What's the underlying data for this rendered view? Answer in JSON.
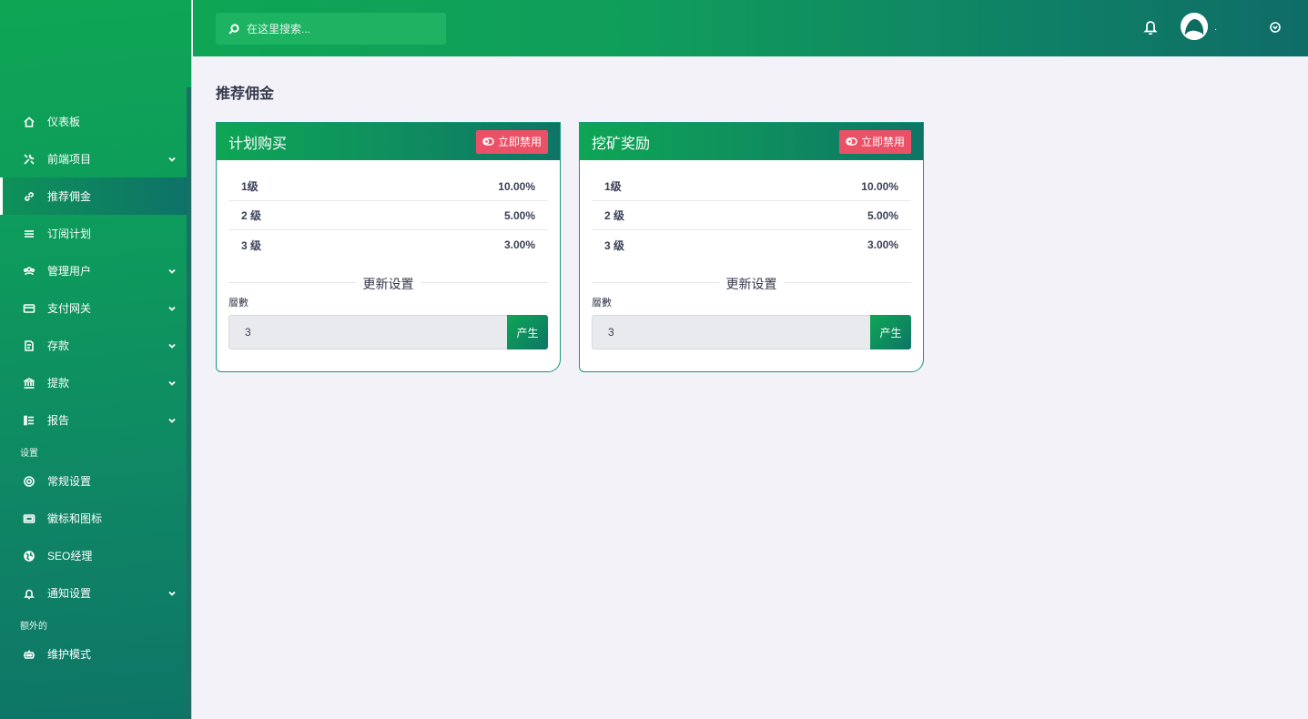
{
  "search": {
    "placeholder": "在这里搜索..."
  },
  "user": {
    "name": "."
  },
  "sidebar": {
    "items": [
      {
        "label": "仪表板",
        "icon": "home-icon",
        "has_submenu": false,
        "active": false
      },
      {
        "label": "前端项目",
        "icon": "tools-icon",
        "has_submenu": true,
        "active": false
      },
      {
        "label": "推荐佣金",
        "icon": "link-icon",
        "has_submenu": false,
        "active": true
      },
      {
        "label": "订阅计划",
        "icon": "list-icon",
        "has_submenu": false,
        "active": false
      },
      {
        "label": "管理用户",
        "icon": "users-icon",
        "has_submenu": true,
        "active": false
      },
      {
        "label": "支付网关",
        "icon": "credit-card-icon",
        "has_submenu": true,
        "active": false
      },
      {
        "label": "存款",
        "icon": "deposit-icon",
        "has_submenu": true,
        "active": false
      },
      {
        "label": "提款",
        "icon": "bank-icon",
        "has_submenu": true,
        "active": false
      },
      {
        "label": "报告",
        "icon": "report-list-icon",
        "has_submenu": true,
        "active": false
      }
    ],
    "section_settings": "设置",
    "settings_items": [
      {
        "label": "常规设置",
        "icon": "life-ring-icon",
        "has_submenu": false
      },
      {
        "label": "徽标和图标",
        "icon": "image-icon",
        "has_submenu": false
      },
      {
        "label": "SEO经理",
        "icon": "globe-icon",
        "has_submenu": false
      },
      {
        "label": "通知设置",
        "icon": "bell-icon",
        "has_submenu": true
      }
    ],
    "section_extra": "额外的",
    "extra_items": [
      {
        "label": "维护模式",
        "icon": "robot-icon",
        "has_submenu": false
      }
    ]
  },
  "page": {
    "title": "推荐佣金"
  },
  "cards": [
    {
      "title": "计划购买",
      "disable_label": "立即禁用",
      "levels": [
        {
          "level": "1级",
          "value": "10.00%"
        },
        {
          "level": "2 级",
          "value": "5.00%"
        },
        {
          "level": "3 级",
          "value": "3.00%"
        }
      ],
      "update_label": "更新设置",
      "field_label": "層數",
      "field_value": "3",
      "generate_label": "产生"
    },
    {
      "title": "挖矿奖励",
      "disable_label": "立即禁用",
      "levels": [
        {
          "level": "1级",
          "value": "10.00%"
        },
        {
          "level": "2 级",
          "value": "5.00%"
        },
        {
          "level": "3 级",
          "value": "3.00%"
        }
      ],
      "update_label": "更新设置",
      "field_label": "層數",
      "field_value": "3",
      "generate_label": "产生"
    }
  ]
}
